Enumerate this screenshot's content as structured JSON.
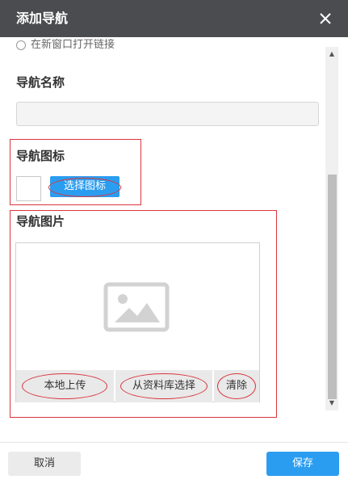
{
  "dialog": {
    "title": "添加导航",
    "close_icon": "close-icon"
  },
  "form": {
    "clipped_option_label": "在新窗口打开链接",
    "nav_name": {
      "label": "导航名称",
      "value": "",
      "placeholder": ""
    },
    "nav_icon": {
      "label": "导航图标",
      "choose_button": "选择图标"
    },
    "nav_image": {
      "label": "导航图片",
      "placeholder_icon": "image-icon",
      "upload_button": "本地上传",
      "library_button": "从资料库选择",
      "clear_button": "清除"
    }
  },
  "footer": {
    "cancel_label": "取消",
    "save_label": "保存"
  },
  "colors": {
    "header_bg": "#4a4c4f",
    "primary": "#2b9df0",
    "annotation_red": "#d9363e"
  }
}
